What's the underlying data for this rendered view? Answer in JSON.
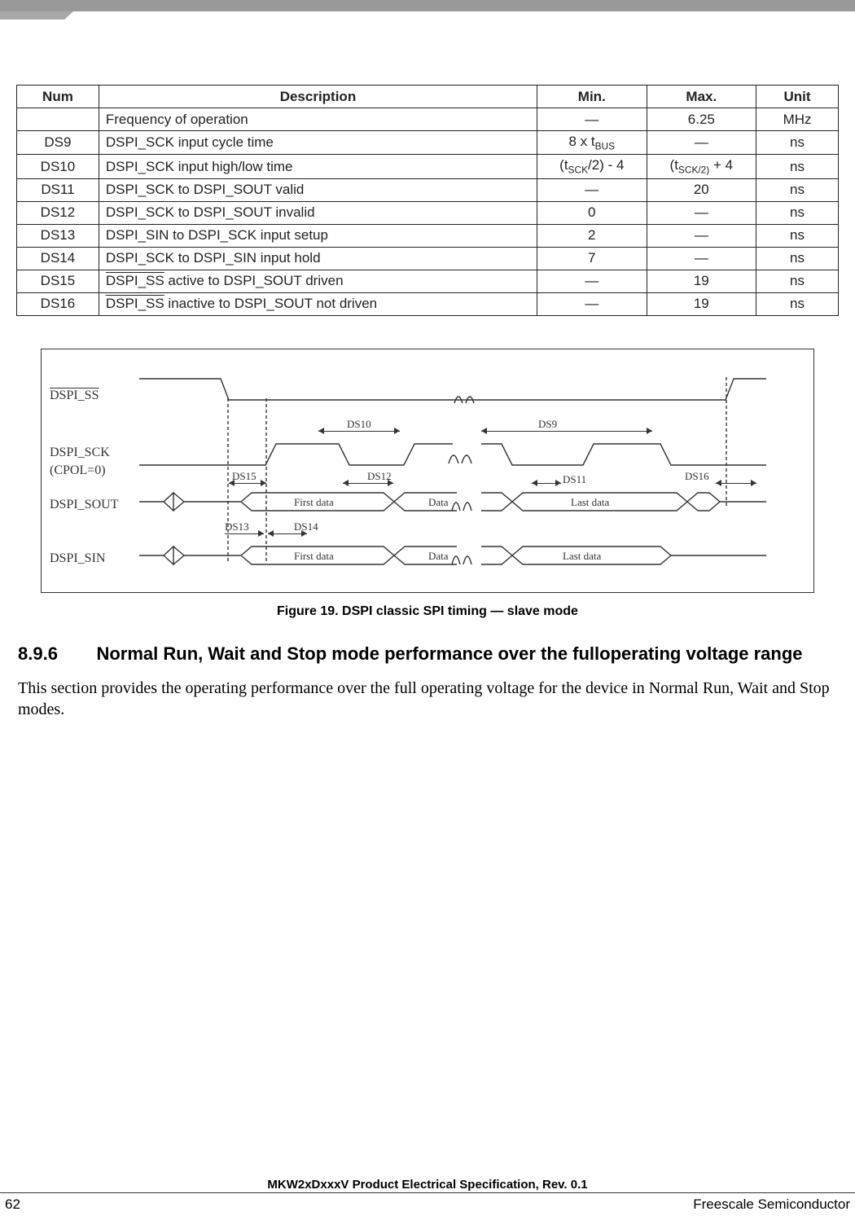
{
  "table": {
    "headers": [
      "Num",
      "Description",
      "Min.",
      "Max.",
      "Unit"
    ],
    "rows": [
      {
        "num": "",
        "desc": "Frequency of operation",
        "min": "—",
        "max": "6.25",
        "unit": "MHz"
      },
      {
        "num": "DS9",
        "desc": "DSPI_SCK input cycle time",
        "min": "8 x t",
        "min_sub": "BUS",
        "max": "—",
        "unit": "ns"
      },
      {
        "num": "DS10",
        "desc": "DSPI_SCK input high/low time",
        "min": "(t",
        "min_sub": "SCK",
        "min_tail": "/2) - 4",
        "max": "(t",
        "max_sub": "SCK/2)",
        "max_tail": " + 4",
        "unit": "ns"
      },
      {
        "num": "DS11",
        "desc": "DSPI_SCK to DSPI_SOUT valid",
        "min": "—",
        "max": "20",
        "unit": "ns"
      },
      {
        "num": "DS12",
        "desc": "DSPI_SCK to DSPI_SOUT invalid",
        "min": "0",
        "max": "—",
        "unit": "ns"
      },
      {
        "num": "DS13",
        "desc": "DSPI_SIN to DSPI_SCK input setup",
        "min": "2",
        "max": "—",
        "unit": "ns"
      },
      {
        "num": "DS14",
        "desc": "DSPI_SCK to DSPI_SIN input hold",
        "min": "7",
        "max": "—",
        "unit": "ns"
      },
      {
        "num": "DS15",
        "desc_pre": "DSPI_SS",
        "desc_post": " active to DSPI_SOUT driven",
        "min": "—",
        "max": "19",
        "unit": "ns"
      },
      {
        "num": "DS16",
        "desc_pre": "DSPI_SS",
        "desc_post": " inactive to DSPI_SOUT not driven",
        "min": "—",
        "max": "19",
        "unit": "ns"
      }
    ]
  },
  "diagram": {
    "signals": {
      "ss": "DSPI_SS",
      "sck": "DSPI_SCK",
      "cpol": "(CPOL=0)",
      "sout": "DSPI_SOUT",
      "sin": "DSPI_SIN"
    },
    "labels": {
      "ds9": "DS9",
      "ds10": "DS10",
      "ds11": "DS11",
      "ds12": "DS12",
      "ds13": "DS13",
      "ds14": "DS14",
      "ds15": "DS15",
      "ds16": "DS16",
      "first": "First data",
      "data": "Data",
      "last": "Last data"
    }
  },
  "figure_caption": "Figure 19. DSPI classic SPI timing — slave mode",
  "section": {
    "number": "8.9.6",
    "title": "Normal Run, Wait and Stop mode performance over the fulloperating voltage range",
    "body": "This section provides the operating performance over the full operating voltage for the device in Normal Run, Wait and Stop modes."
  },
  "footer": {
    "doc": "MKW2xDxxxV Product Electrical Specification, Rev. 0.1",
    "page": "62",
    "company": "Freescale Semiconductor"
  }
}
